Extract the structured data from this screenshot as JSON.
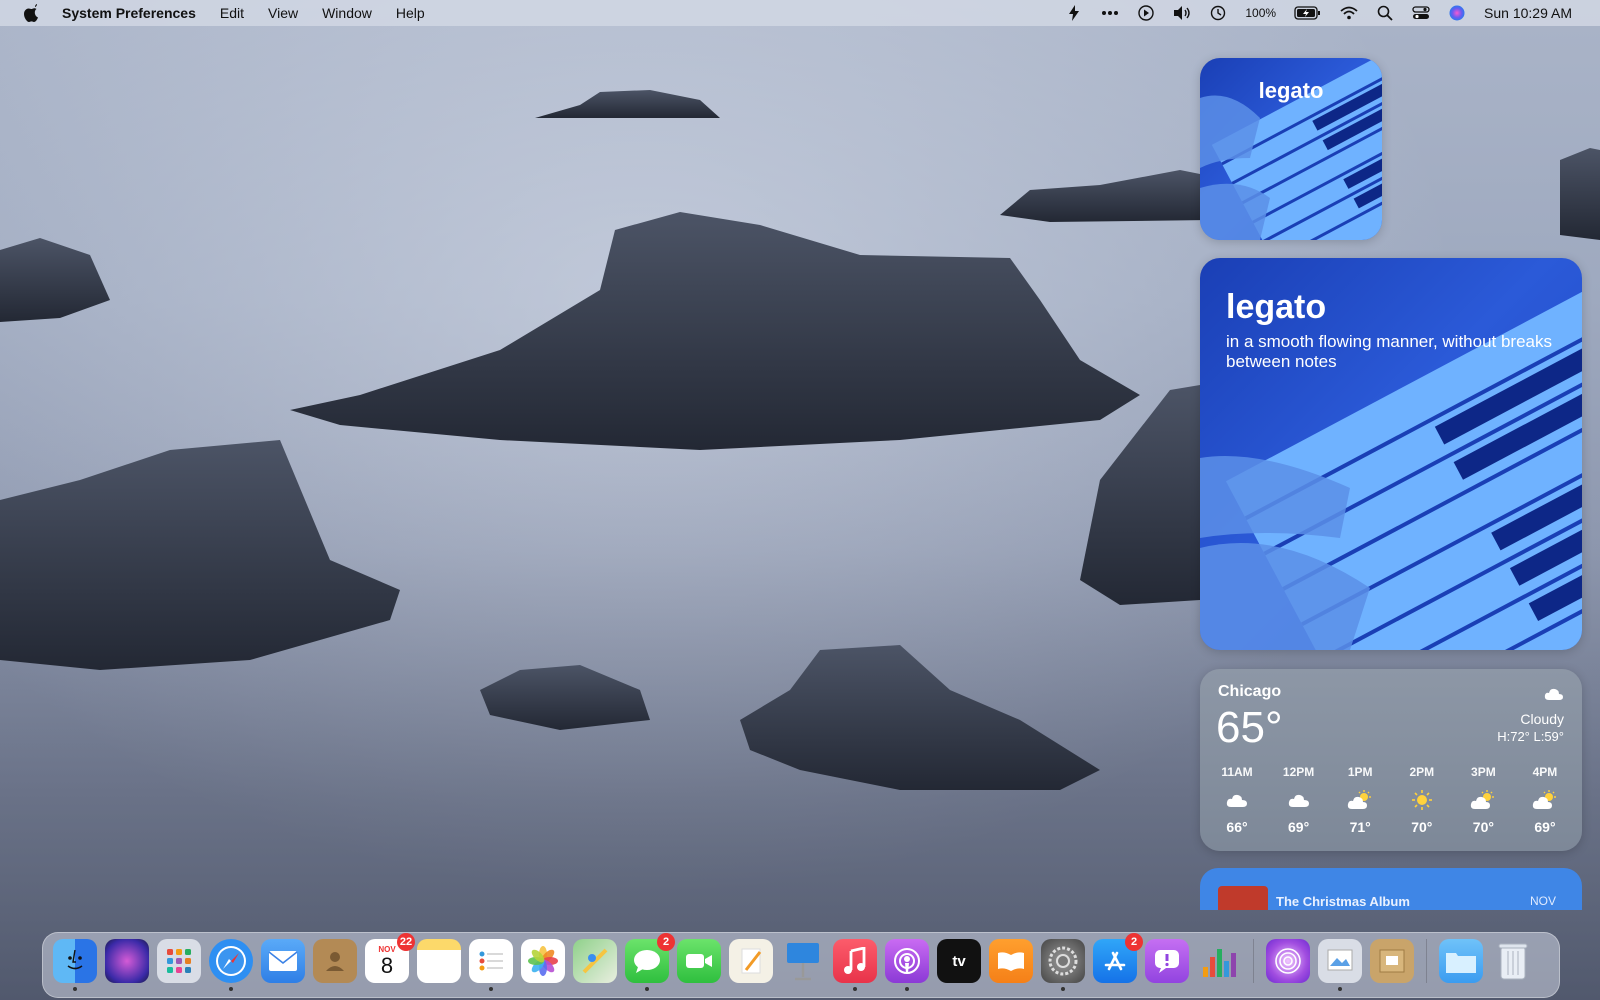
{
  "menubar": {
    "app_name": "System Preferences",
    "menus": [
      "Edit",
      "View",
      "Window",
      "Help"
    ],
    "battery_percent": "100%",
    "clock": "Sun 10:29 AM"
  },
  "widgets": {
    "word_small": {
      "word": "legato"
    },
    "word_large": {
      "word": "legato",
      "definition": "in a smooth flowing manner, without breaks between notes"
    },
    "weather": {
      "city": "Chicago",
      "temperature": "65°",
      "condition": "Cloudy",
      "high_low": "H:72° L:59°",
      "hours": [
        {
          "time": "11AM",
          "icon": "cloud-icon",
          "temp": "66°"
        },
        {
          "time": "12PM",
          "icon": "cloud-icon",
          "temp": "69°"
        },
        {
          "time": "1PM",
          "icon": "partly-sunny-icon",
          "temp": "71°"
        },
        {
          "time": "2PM",
          "icon": "sun-icon",
          "temp": "70°"
        },
        {
          "time": "3PM",
          "icon": "partly-sunny-icon",
          "temp": "70°"
        },
        {
          "time": "4PM",
          "icon": "partly-sunny-icon",
          "temp": "69°"
        }
      ]
    },
    "music": {
      "album": "The Christmas Album",
      "month": "NOV"
    }
  },
  "dock": {
    "calendar": {
      "month": "NOV",
      "day": "8",
      "badge": "22"
    },
    "messages_badge": "2",
    "appstore_badge": "2",
    "apps": [
      {
        "name": "Finder",
        "icon": "finder-icon",
        "color": "#2f8cf0"
      },
      {
        "name": "Siri",
        "icon": "siri-icon",
        "color": "#5a3ed6"
      },
      {
        "name": "Launchpad",
        "icon": "launchpad-icon",
        "color": "#d9dde6"
      },
      {
        "name": "Safari",
        "icon": "safari-icon",
        "color": "#2e8ff2"
      },
      {
        "name": "Mail",
        "icon": "mail-icon",
        "color": "#3c93f0"
      },
      {
        "name": "Contacts",
        "icon": "contacts-icon",
        "color": "#b38a55"
      }
    ]
  },
  "colors": {
    "accent": "#2b5ad8",
    "badge": "#e33333"
  }
}
